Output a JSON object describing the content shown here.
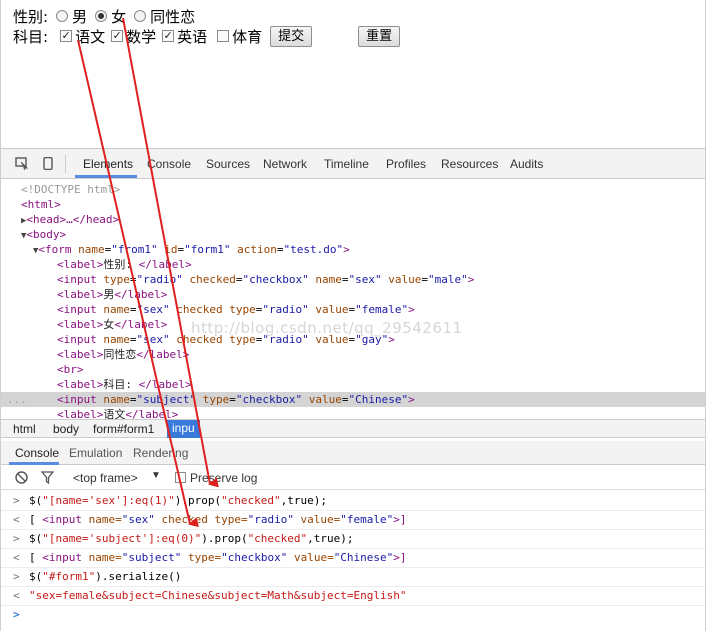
{
  "form": {
    "sex_label": "性别:",
    "sex_options": [
      "男",
      "女",
      "同性恋"
    ],
    "subject_label": "科目:",
    "subject_options": [
      "语文",
      "数学",
      "英语",
      "体育"
    ],
    "submit_label": "提交",
    "reset_label": "重置"
  },
  "devtools": {
    "tabs": [
      "Elements",
      "Console",
      "Sources",
      "Network",
      "Timeline",
      "Profiles",
      "Resources",
      "Audits"
    ],
    "dom": {
      "l0": "<!DOCTYPE html>",
      "l1": "<html>",
      "l2": "<head>…</head>",
      "l3": "<body>",
      "form_open": [
        "form",
        "name",
        "\"from1\"",
        "id",
        "\"form1\"",
        "action",
        "\"test.do\""
      ],
      "label1": "性别: ",
      "input1": [
        "input",
        "type",
        "\"radio\"",
        "checked",
        "\"checkbox\"",
        "name",
        "\"sex\"",
        "value",
        "\"male\""
      ],
      "label2": "男",
      "input2": [
        "input",
        "name",
        "\"sex\"",
        "checked",
        "type",
        "\"radio\"",
        "value",
        "\"female\""
      ],
      "label3": "女",
      "input3": [
        "input",
        "name",
        "\"sex\"",
        "checked",
        "type",
        "\"radio\"",
        "value",
        "\"gay\""
      ],
      "label4": "同性恋",
      "br": "<br>",
      "label5": "科目: ",
      "input4": [
        "input",
        "name",
        "\"subject\"",
        "type",
        "\"checkbox\"",
        "value",
        "\"Chinese\""
      ],
      "label6": "语文",
      "ellipsis": "..."
    },
    "watermark": "http://blog.csdn.net/qq_29542611",
    "breadcrumbs": [
      "html",
      "body",
      "form#form1",
      "inpu"
    ],
    "drawer_tabs": [
      "Console",
      "Emulation",
      "Rendering"
    ],
    "console_toolbar": {
      "frame": "<top frame>",
      "preserve_log": "Preserve log"
    },
    "console": {
      "l1_pre": "$(",
      "l1_str": "\"[name='sex']:eq(1)\"",
      "l1_post": ").prop(",
      "l1_str2": "\"checked\"",
      "l1_end": ",true);",
      "r1_open": "[ ",
      "r1_tag": "<input ",
      "r1_a1": "name=",
      "r1_v1": "\"sex\"",
      "r1_a2": " checked type=",
      "r1_v2": "\"radio\"",
      "r1_a3": " value=",
      "r1_v3": "\"female\"",
      "r1_close": ">]",
      "l2_pre": "$(",
      "l2_str": "\"[name='subject']:eq(0)\"",
      "l2_post": ").prop(",
      "l2_str2": "\"checked\"",
      "l2_end": ",true);",
      "r2_open": "[ ",
      "r2_tag": "<input ",
      "r2_a1": "name=",
      "r2_v1": "\"subject\"",
      "r2_a2": " type=",
      "r2_v2": "\"checkbox\"",
      "r2_a3": " value=",
      "r2_v3": "\"Chinese\"",
      "r2_close": ">]",
      "l3_pre": "$(",
      "l3_str": "\"#form1\"",
      "l3_post": ").serialize()",
      "r3": "\"sex=female&subject=Chinese&subject=Math&subject=English\""
    }
  },
  "colors": {
    "annotation_arrow": "#e0201f",
    "selected_crumb": "#3879d9",
    "tab_underline": "#5a8be0"
  }
}
